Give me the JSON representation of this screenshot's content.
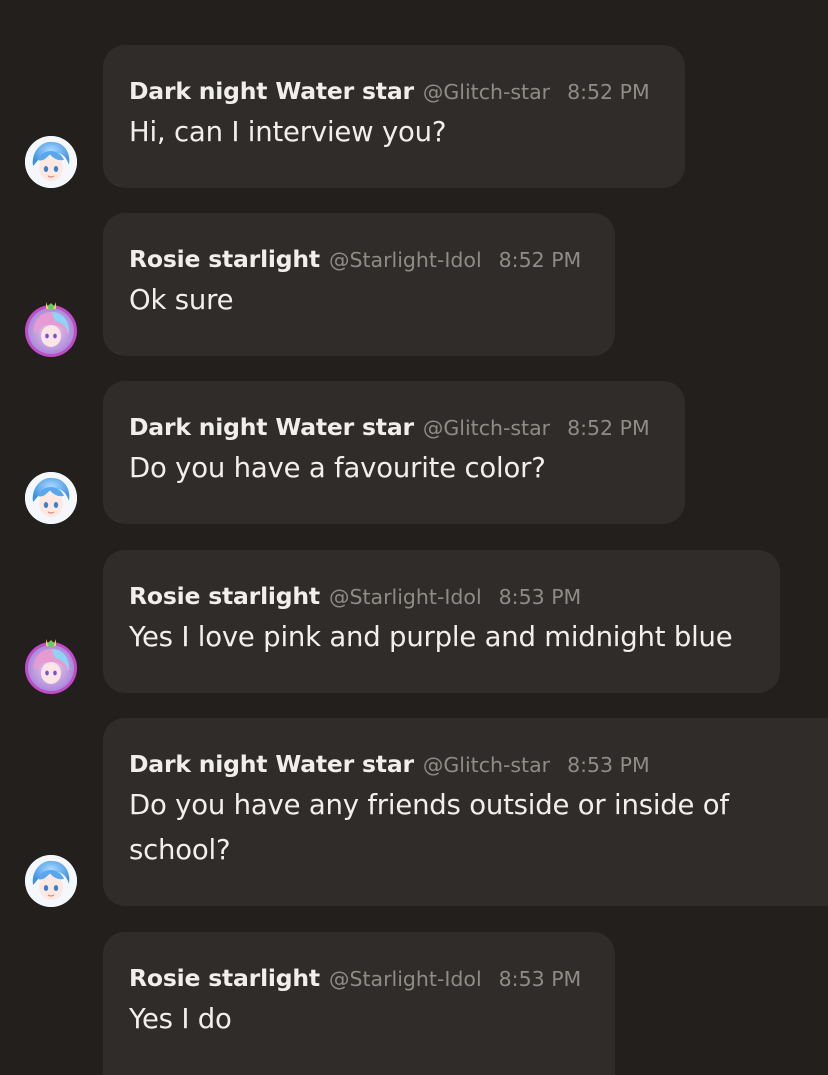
{
  "colors": {
    "background": "#221f1d",
    "bubble": "#2f2c2a",
    "name": "#f1efec",
    "muted": "#8f8b87",
    "rosie_ring": "#c24bc9"
  },
  "messages": [
    {
      "author": "Dark night Water star",
      "handle": "@Glitch-star",
      "time": "8:52 PM",
      "text": "Hi, can I interview you?",
      "avatar": "blue-hair-avatar"
    },
    {
      "author": "Rosie starlight",
      "handle": "@Starlight-Idol",
      "time": "8:52 PM",
      "text": "Ok sure",
      "avatar": "pink-hair-avatar"
    },
    {
      "author": "Dark night Water star",
      "handle": "@Glitch-star",
      "time": "8:52 PM",
      "text": "Do you have a favourite color?",
      "avatar": "blue-hair-avatar"
    },
    {
      "author": "Rosie starlight",
      "handle": "@Starlight-Idol",
      "time": "8:53 PM",
      "text": "Yes I love pink and purple and midnight blue",
      "avatar": "pink-hair-avatar"
    },
    {
      "author": "Dark night Water star",
      "handle": "@Glitch-star",
      "time": "8:53 PM",
      "text": "Do you have any friends outside or inside of school?",
      "avatar": "blue-hair-avatar"
    },
    {
      "author": "Rosie starlight",
      "handle": "@Starlight-Idol",
      "time": "8:53 PM",
      "text": "Yes I do",
      "avatar": "pink-hair-avatar"
    }
  ]
}
